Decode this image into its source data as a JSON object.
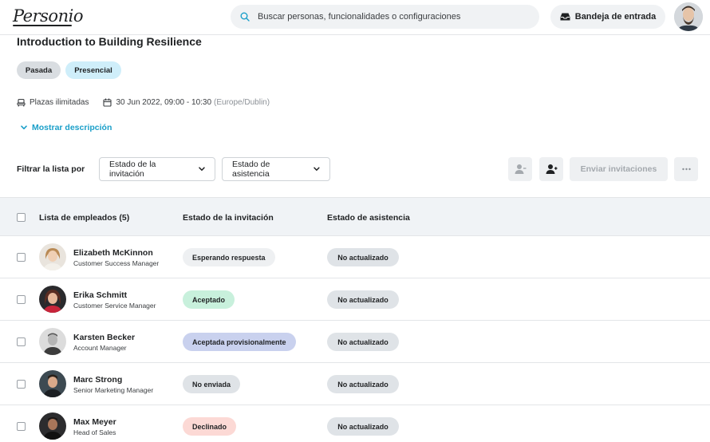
{
  "header": {
    "logo": "Personio",
    "search_placeholder": "Buscar personas, funcionalidades o configuraciones",
    "inbox_label": "Bandeja de entrada"
  },
  "event": {
    "title": "Introduction to Building Resilience",
    "tags": [
      "Pasada",
      "Presencial"
    ],
    "seats": "Plazas ilimitadas",
    "datetime": "30 Jun 2022, 09:00 - 10:30",
    "timezone": "(Europe/Dublin)",
    "show_description": "Mostrar descripción"
  },
  "filters": {
    "label": "Filtrar la lista por",
    "invitation_status": "Estado de la invitación",
    "attendance_status": "Estado de asistencia"
  },
  "actions": {
    "send_invitations": "Enviar invitaciones"
  },
  "table": {
    "columns": [
      "Lista de empleados (5)",
      "Estado de la invitación",
      "Estado de asistencia"
    ],
    "rows": [
      {
        "name": "Elizabeth McKinnon",
        "role": "Customer Success Manager",
        "invitation": "Esperando respuesta",
        "attendance": "No actualizado"
      },
      {
        "name": "Erika Schmitt",
        "role": "Customer Service Manager",
        "invitation": "Aceptado",
        "attendance": "No actualizado"
      },
      {
        "name": "Karsten Becker",
        "role": "Account Manager",
        "invitation": "Aceptada provisionalmente",
        "attendance": "No actualizado"
      },
      {
        "name": "Marc Strong",
        "role": "Senior Marketing Manager",
        "invitation": "No enviada",
        "attendance": "No actualizado"
      },
      {
        "name": "Max Meyer",
        "role": "Head of Sales",
        "invitation": "Declinado",
        "attendance": "No actualizado"
      }
    ]
  },
  "colors": {
    "accent": "#1a9fc9",
    "status_waiting": "#eef0f2",
    "status_accepted": "#c8f0dc",
    "status_tentative": "#c9d1ee",
    "status_not_sent": "#dfe3e7",
    "status_declined": "#fcd9d5",
    "tag_past": "#d9dde1",
    "tag_in_person": "#cfeefa"
  }
}
